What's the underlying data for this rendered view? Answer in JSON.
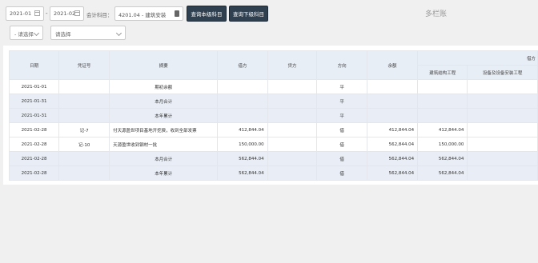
{
  "filters": {
    "start_date": "2021-01",
    "end_date": "2021-02",
    "date_separator": "-",
    "account_label": "会计科目：",
    "account_value": "4201.04 - 建筑安装",
    "prev_button": "查询本级科目",
    "next_button": "查询下级科目",
    "select1": "- 请选择",
    "select2": "请选择"
  },
  "page_title": "多栏账",
  "table": {
    "headers": {
      "date": "日期",
      "voucher": "凭证号",
      "summary": "摘要",
      "debit": "借方",
      "credit": "贷方",
      "direction": "方向",
      "balance": "余额",
      "group": "借方",
      "sub1": "建筑结构工程",
      "sub2": "设备及设备安装工程"
    },
    "rows": [
      {
        "date": "2021-01-01",
        "voucher": "",
        "summary": "期初余额",
        "debit": "",
        "credit": "",
        "dir": "平",
        "balance": "",
        "c1": "",
        "c2": ""
      },
      {
        "date": "2021-01-31",
        "voucher": "",
        "summary": "本月合计",
        "debit": "",
        "credit": "",
        "dir": "平",
        "balance": "",
        "c1": "",
        "c2": ""
      },
      {
        "date": "2021-01-31",
        "voucher": "",
        "summary": "本年累计",
        "debit": "",
        "credit": "",
        "dir": "平",
        "balance": "",
        "c1": "",
        "c2": ""
      },
      {
        "date": "2021-02-28",
        "voucher": "记-7",
        "summary": "付天源盈世项目基地开挖费，收到全部发票",
        "debit": "412,844.04",
        "credit": "",
        "dir": "借",
        "balance": "412,844.04",
        "c1": "412,844.04",
        "c2": ""
      },
      {
        "date": "2021-02-28",
        "voucher": "记-10",
        "summary": "天源盈世收到钢材一批",
        "debit": "150,000.00",
        "credit": "",
        "dir": "借",
        "balance": "562,844.04",
        "c1": "150,000.00",
        "c2": ""
      },
      {
        "date": "2021-02-28",
        "voucher": "",
        "summary": "本月合计",
        "debit": "562,844.04",
        "credit": "",
        "dir": "借",
        "balance": "562,844.04",
        "c1": "562,844.04",
        "c2": ""
      },
      {
        "date": "2021-02-28",
        "voucher": "",
        "summary": "本年累计",
        "debit": "562,844.04",
        "credit": "",
        "dir": "借",
        "balance": "562,844.04",
        "c1": "562,844.04",
        "c2": ""
      }
    ]
  }
}
